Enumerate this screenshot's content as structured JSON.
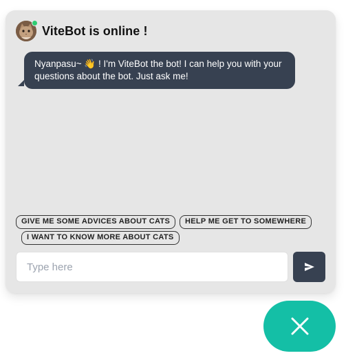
{
  "header": {
    "title": "ViteBot is online !",
    "avatar_icon": "cat-avatar-icon",
    "online_color": "#2ecc71"
  },
  "messages": [
    {
      "sender": "bot",
      "text": "Nyanpasu~ 👋 ! I'm ViteBot the bot! I can help you with your questions about the bot. Just ask me!"
    }
  ],
  "suggestions": [
    "GIVE ME SOME ADVICES ABOUT CATS",
    "HELP ME GET TO SOMEWHERE",
    "I WANT TO KNOW MORE ABOUT CATS"
  ],
  "input": {
    "placeholder": "Type here",
    "value": ""
  },
  "send_button": {
    "icon": "send-icon"
  },
  "close_button": {
    "icon": "close-icon"
  },
  "colors": {
    "panel_bg": "#e6e6e6",
    "bubble_bg": "#374151",
    "accent": "#14bfa6"
  }
}
